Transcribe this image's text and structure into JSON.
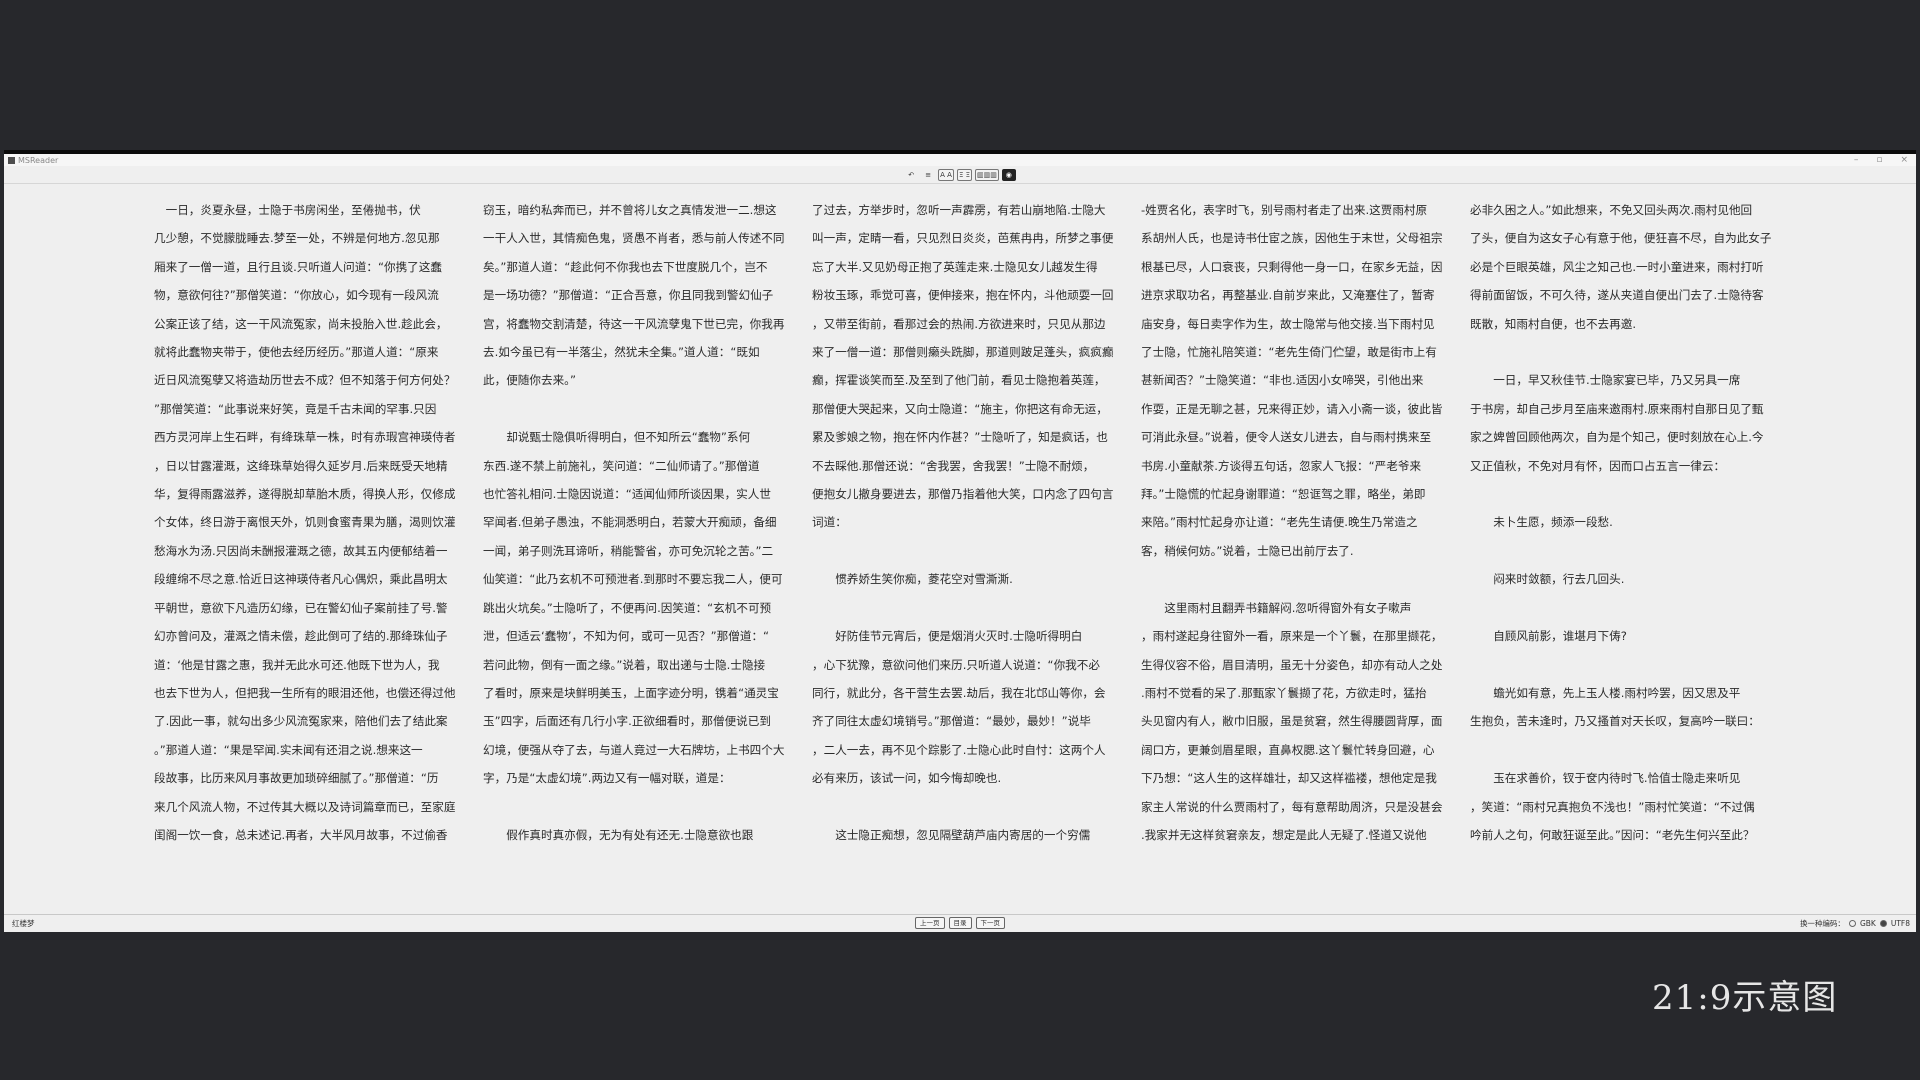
{
  "app": {
    "title": "MSReader"
  },
  "window_controls": {
    "minimize": "–",
    "maximize": "▫",
    "close": "×"
  },
  "toolbar": {
    "undo": "↶",
    "list": "≡",
    "font_size": "A A",
    "spacing": "Ξ Ξ",
    "layout": "▥▥▥",
    "theme": "◉"
  },
  "columns": [
    [
      "　一日，炎夏永昼，士隐于书房闲坐，至倦抛书，伏",
      "几少憩，不觉朦胧睡去.梦至一处，不辨是何地方.忽见那",
      "厢来了一僧一道，且行且谈.只听道人问道：“你携了这蠢",
      "物，意欲何往?”那僧笑道：“你放心，如今现有一段风流",
      "公案正该了结，这一干风流冤家，尚未投胎入世.趁此会，",
      "就将此蠢物夹带于，使他去经历经历。”那道人道：“原来",
      "近日风流冤孽又将造劫历世去不成？但不知落于何方何处？",
      "”那僧笑道：“此事说来好笑，竟是千古未闻的罕事.只因",
      "西方灵河岸上生石畔，有绛珠草一株，时有赤瑕宫神瑛侍者",
      "，日以甘露灌溉，这绛珠草始得久延岁月.后来既受天地精",
      "华，复得雨露滋养，遂得脱却草胎木质，得换人形，仅修成",
      "个女体，终日游于离恨天外，饥则食蜜青果为膳，渴则饮灌",
      "愁海水为汤.只因尚未酬报灌溉之德，故其五内便郁结着一",
      "段缠绵不尽之意.恰近日这神瑛侍者凡心偶炽，乘此昌明太",
      "平朝世，意欲下凡造历幻缘，已在警幻仙子案前挂了号.警",
      "幻亦曾问及，灌溉之情未偿，趁此倒可了结的.那绛珠仙子",
      "道：‘他是甘露之惠，我并无此水可还.他既下世为人，我",
      "也去下世为人，但把我一生所有的眼泪还他，也偿还得过他",
      "了.因此一事，就勾出多少风流冤家来，陪他们去了结此案",
      "。”那道人道：“果是罕闻.实未闻有还泪之说.想来这一",
      "段故事，比历来风月事故更加琐碎细腻了。”那僧道：“历",
      "来几个风流人物，不过传其大概以及诗词篇章而已，至家庭",
      "闺阁一饮一食，总未述记.再者，大半风月故事，不过偷香"
    ],
    [
      "窃玉，暗约私奔而已，并不曾将儿女之真情发泄一二.想这",
      "一干人入世，其情痴色鬼，贤愚不肖者，悉与前人传述不同",
      "矣。”那道人道：“趁此何不你我也去下世度脱几个，岂不",
      "是一场功德？”那僧道：“正合吾意，你且同我到警幻仙子",
      "宫，将蠢物交割清楚，待这一干风流孽鬼下世已完，你我再",
      "去.如今虽已有一半落尘，然犹未全集。”道人道：“既如",
      "此，便随你去来。”",
      "",
      "　　却说甄士隐俱听得明白，但不知所云“蠢物”系何",
      "东西.遂不禁上前施礼，笑问道：“二仙师请了。”那僧道",
      "也忙答礼相问.士隐因说道：“适闻仙师所谈因果，实人世",
      "罕闻者.但弟子愚浊，不能洞悉明白，若蒙大开痴顽，备细",
      "一闻，弟子则洗耳谛听，稍能警省，亦可免沉轮之苦。”二",
      "仙笑道：“此乃玄机不可预泄者.到那时不要忘我二人，便可",
      "跳出火坑矣。”士隐听了，不便再问.因笑道：“玄机不可预",
      "泄，但适云‘蠢物’，不知为何，或可一见否？”那僧道：“",
      "若问此物，倒有一面之缘。”说着，取出递与士隐.士隐接",
      "了看时，原来是块鲜明美玉，上面字迹分明，镌着“通灵宝",
      "玉”四字，后面还有几行小字.正欲细看时，那僧便说已到",
      "幻境，便强从夺了去，与道人竟过一大石牌坊，上书四个大",
      "字，乃是“太虚幻境”.两边又有一幅对联，道是：",
      "",
      "　　假作真时真亦假，无为有处有还无.士隐意欲也跟"
    ],
    [
      "了过去，方举步时，忽听一声霹雳，有若山崩地陷.士隐大",
      "叫一声，定睛一看，只见烈日炎炎，芭蕉冉冉，所梦之事便",
      "忘了大半.又见奶母正抱了英莲走来.士隐见女儿越发生得",
      "粉妆玉琢，乖觉可喜，便伸接来，抱在怀内，斗他顽耍一回",
      "，又带至街前，看那过会的热闹.方欲进来时，只见从那边",
      "来了一僧一道：那僧则癞头跣脚，那道则跛足蓬头，疯疯癫",
      "癫，挥霍谈笑而至.及至到了他门前，看见士隐抱着英莲，",
      "那僧便大哭起来，又向士隐道：“施主，你把这有命无运，",
      "累及爹娘之物，抱在怀内作甚？”士隐听了，知是疯话，也",
      "不去睬他.那僧还说：“舍我罢，舍我罢！”士隐不耐烦，",
      "便抱女儿撤身要进去，那僧乃指着他大笑，口内念了四句言",
      "词道：",
      "",
      "　　惯养娇生笑你痴，菱花空对雪澌澌.",
      "",
      "　　好防佳节元宵后，便是烟消火灭时.士隐听得明白",
      "，心下犹豫，意欲问他们来历.只听道人说道：“你我不必",
      "同行，就此分，各干营生去罢.劫后，我在北邙山等你，会",
      "齐了同往太虚幻境销号。”那僧道：“最妙，最妙！”说毕",
      "，二人一去，再不见个踪影了.士隐心此时自忖：这两个人",
      "必有来历，该试一问，如今悔却晚也.",
      "",
      "　　这士隐正痴想，忽见隔壁葫芦庙内寄居的一个穷儒"
    ],
    [
      "-姓贾名化，表字时飞，别号雨村者走了出来.这贾雨村原",
      "系胡州人氏，也是诗书仕宦之族，因他生于末世，父母祖宗",
      "根基已尽，人口衰丧，只剩得他一身一口，在家乡无益，因",
      "进京求取功名，再整基业.自前岁来此，又淹蹇住了，暂寄",
      "庙安身，每日卖字作为生，故士隐常与他交接.当下雨村见",
      "了士隐，忙施礼陪笑道：“老先生倚门伫望，敢是街市上有",
      "甚新闻否？”士隐笑道：“非也.适因小女啼哭，引他出来",
      "作耍，正是无聊之甚，兄来得正妙，请入小斋一谈，彼此皆",
      "可消此永昼。”说着，便令人送女儿进去，自与雨村携来至",
      "书房.小童献茶.方谈得五句话，忽家人飞报：“严老爷来",
      "拜。”士隐慌的忙起身谢罪道：“恕诓驾之罪，略坐，弟即",
      "来陪。”雨村忙起身亦让道：“老先生请便.晚生乃常造之",
      "客，稍候何妨。”说着，士隐已出前厅去了.",
      "",
      "　　这里雨村且翻弄书籍解闷.忽听得窗外有女子嗽声",
      "，雨村遂起身往窗外一看，原来是一个丫鬟，在那里撷花，",
      "生得仪容不俗，眉目清明，虽无十分姿色，却亦有动人之处",
      ".雨村不觉看的呆了.那甄家丫鬟撷了花，方欲走时，猛抬",
      "头见窗内有人，敝巾旧服，虽是贫窘，然生得腰圆背厚，面",
      "阔口方，更兼剑眉星眼，直鼻权腮.这丫鬟忙转身回避，心",
      "下乃想：“这人生的这样雄壮，却又这样褴褛，想他定是我",
      "家主人常说的什么贾雨村了，每有意帮助周济，只是没甚会",
      ".我家并无这样贫窘亲友，想定是此人无疑了.怪道又说他"
    ],
    [
      "必非久困之人。”如此想来，不免又回头两次.雨村见他回",
      "了头，便自为这女子心有意于他，便狂喜不尽，自为此女子",
      "必是个巨眼英雄，风尘之知己也.一时小童进来，雨村打听",
      "得前面留饭，不可久待，遂从夹道自便出门去了.士隐待客",
      "既散，知雨村自便，也不去再邀.",
      "",
      "　　一日，早又秋佳节.士隐家宴已毕，乃又另具一席",
      "于书房，却自己步月至庙来邀雨村.原来雨村自那日见了甄",
      "家之婢曾回顾他两次，自为是个知己，便时刻放在心上.今",
      "又正值秋，不免对月有怀，因而口占五言一律云：",
      "",
      "　　未卜生愿，频添一段愁.",
      "",
      "　　闷来时敛额，行去几回头.",
      "",
      "　　自顾风前影，谁堪月下俦?",
      "",
      "　　蟾光如有意，先上玉人楼.雨村吟罢，因又思及平",
      "生抱负，苦未逢时，乃又搔首对天长叹，复高吟一联曰：",
      "",
      "　　玉在求善价，钗于奁内待时飞.恰值士隐走来听见",
      "，笑道：“雨村兄真抱负不浅也！”雨村忙笑道：“不过偶",
      "吟前人之句，何敢狂诞至此。”因问：“老先生何兴至此？"
    ]
  ],
  "statusbar": {
    "book_title": "红楼梦",
    "prev_page": "上一页",
    "toc": "目录",
    "next_page": "下一页",
    "encoding_label": "换一种编码：",
    "encoding_gbk": "GBK",
    "encoding_utf8": "UTF8"
  },
  "caption": "21:9示意图"
}
